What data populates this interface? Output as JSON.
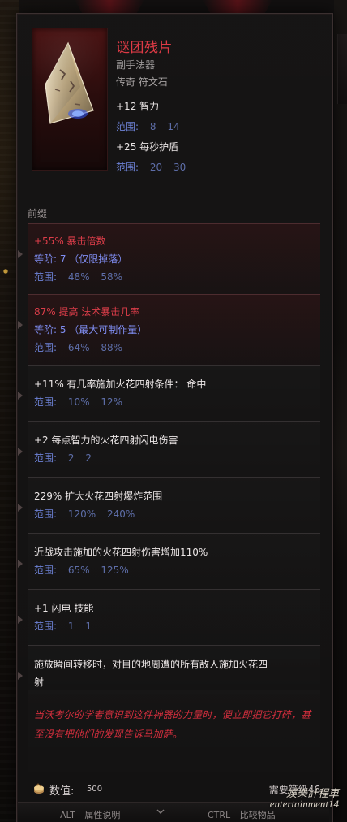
{
  "colors": {
    "legendary": "#db3d49",
    "range": "#6d82d6",
    "tier": "#7f8cf0",
    "text": "#ece7e7"
  },
  "item": {
    "name": "谜团残片",
    "subtype": "副手法器",
    "rarity": "传奇 符文石",
    "stats": [
      {
        "text": "+12 智力",
        "range_label": "范围:",
        "range_a": "8",
        "range_b": "14"
      },
      {
        "text": "+25 每秒护盾",
        "range_label": "范围:",
        "range_a": "20",
        "range_b": "30"
      }
    ]
  },
  "section": {
    "prefix_label": "前缀"
  },
  "affixes": [
    {
      "type": "special",
      "line1": "+55% 暴击倍数",
      "line2": "等阶: 7 （仅限掉落）",
      "range_label": "范围:",
      "range_a": "48%",
      "range_b": "58%"
    },
    {
      "type": "special",
      "line1": "87% 提高 法术暴击几率",
      "line2": "等阶: 5 （最大可制作量）",
      "range_label": "范围:",
      "range_a": "64%",
      "range_b": "88%"
    },
    {
      "type": "normal",
      "line1": "+11% 有几率施加火花四射条件： 命中",
      "range_label": "范围:",
      "range_a": "10%",
      "range_b": "12%"
    },
    {
      "type": "normal",
      "line1": "+2 每点智力的火花四射闪电伤害",
      "range_label": "范围:",
      "range_a": "2",
      "range_b": "2"
    },
    {
      "type": "normal",
      "line1": "229% 扩大火花四射爆炸范围",
      "range_label": "范围:",
      "range_a": "120%",
      "range_b": "240%"
    },
    {
      "type": "normal",
      "line1": "近战攻击施加的火花四射伤害增加110%",
      "range_label": "范围:",
      "range_a": "65%",
      "range_b": "125%"
    },
    {
      "type": "normal",
      "line1": "+1 闪电 技能",
      "range_label": "范围:",
      "range_a": "1",
      "range_b": "1"
    },
    {
      "type": "normal",
      "line1": "施放瞬间转移时，对目的地周遭的所有敌人施加火花四",
      "line2": "射"
    }
  ],
  "flavor": {
    "text": "当沃考尔的学者意识到这件神器的力量时，便立即把它打碎，甚至没有把他们的发现告诉马加萨。"
  },
  "footer": {
    "value_label": "数值:",
    "value_number": "500",
    "required_level": "需要等级46"
  },
  "bottom_bar": {
    "left_key": "ALT",
    "left_label": "属性说明",
    "right_key": "CTRL",
    "right_label": "比较物品"
  },
  "watermark": {
    "line1": "娛樂計程車",
    "line2": "entertainment14"
  },
  "icons": {
    "item_art": "runestone-icon",
    "value": "coin-icon",
    "bottom_chevron": "chevron-down-icon"
  }
}
